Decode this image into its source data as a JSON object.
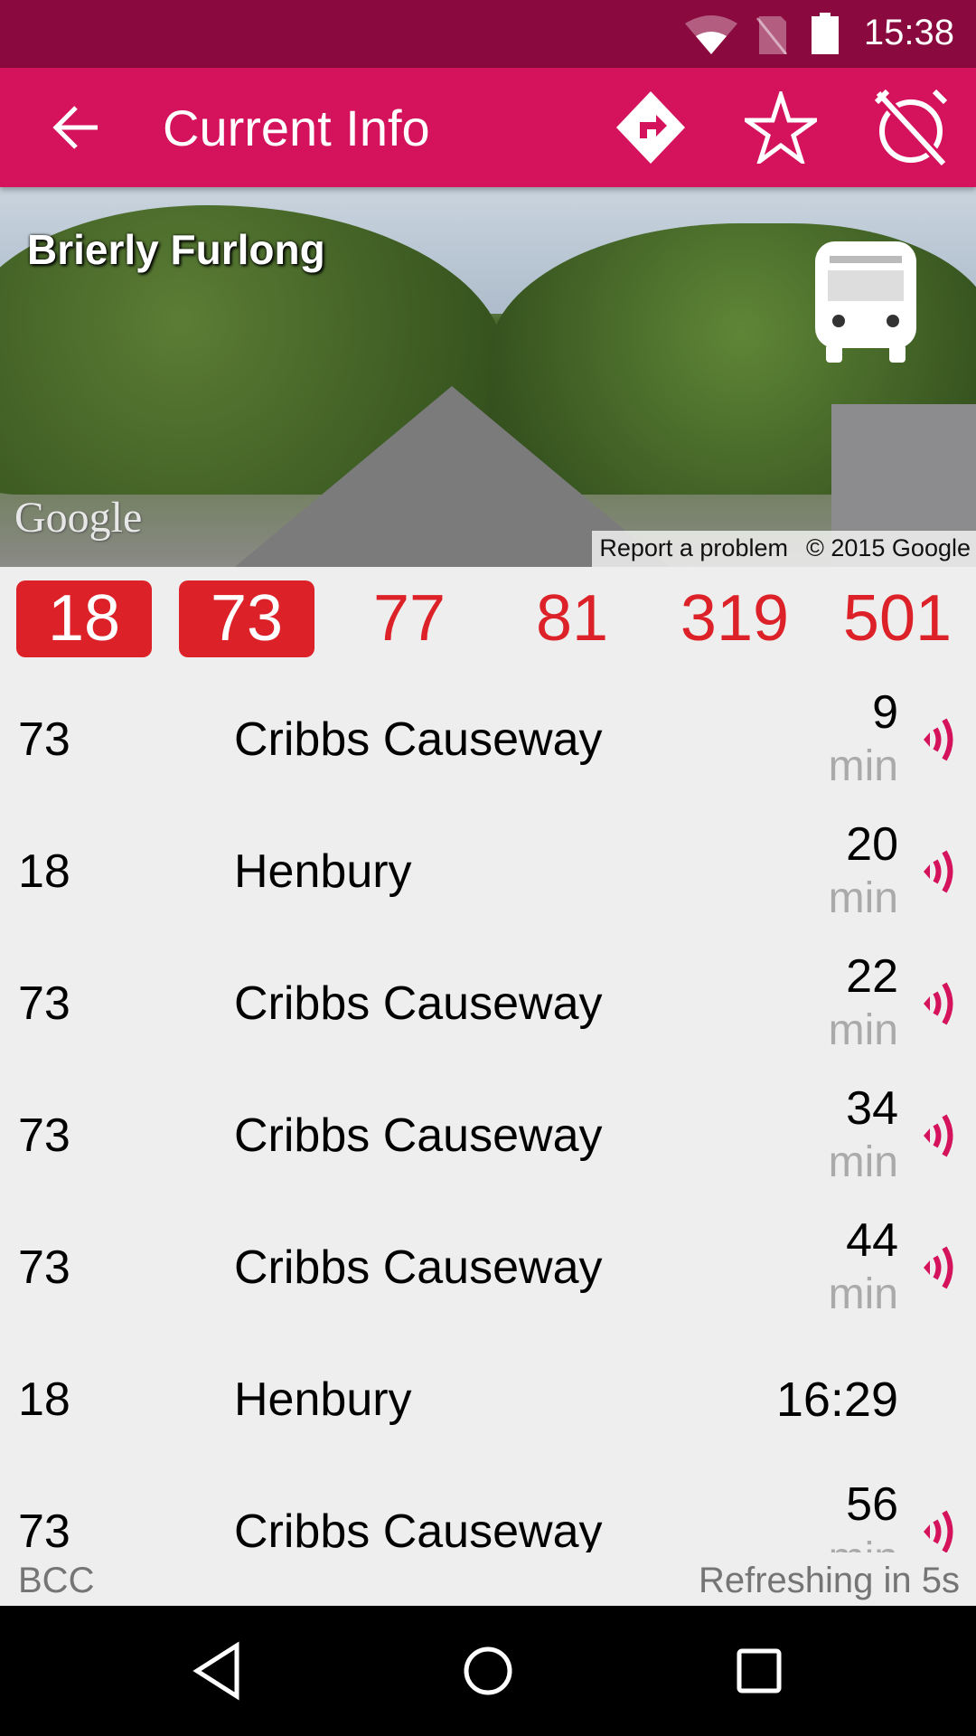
{
  "status_bar": {
    "time": "15:38",
    "icons": [
      "wifi-icon",
      "no-sim-icon",
      "battery-icon"
    ]
  },
  "app_bar": {
    "title": "Current Info",
    "actions": [
      "directions-icon",
      "star-icon",
      "alarm-off-icon"
    ]
  },
  "street_view": {
    "stop_name": "Brierly Furlong",
    "google_logo": "Google",
    "report": "Report a problem",
    "copyright": "© 2015 Google"
  },
  "routes": [
    {
      "label": "18",
      "selected": true
    },
    {
      "label": "73",
      "selected": true
    },
    {
      "label": "77",
      "selected": false
    },
    {
      "label": "81",
      "selected": false
    },
    {
      "label": "319",
      "selected": false
    },
    {
      "label": "501",
      "selected": false
    }
  ],
  "departures": [
    {
      "route": "73",
      "destination": "Cribbs Causeway",
      "value": "9",
      "unit": "min",
      "realtime": true
    },
    {
      "route": "18",
      "destination": "Henbury",
      "value": "20",
      "unit": "min",
      "realtime": true
    },
    {
      "route": "73",
      "destination": "Cribbs Causeway",
      "value": "22",
      "unit": "min",
      "realtime": true
    },
    {
      "route": "73",
      "destination": "Cribbs Causeway",
      "value": "34",
      "unit": "min",
      "realtime": true
    },
    {
      "route": "73",
      "destination": "Cribbs Causeway",
      "value": "44",
      "unit": "min",
      "realtime": true
    },
    {
      "route": "18",
      "destination": "Henbury",
      "value": "16:29",
      "unit": "",
      "realtime": false
    },
    {
      "route": "73",
      "destination": "Cribbs Causeway",
      "value": "56",
      "unit": "min",
      "realtime": true
    }
  ],
  "footer": {
    "source": "BCC",
    "refresh": "Refreshing in 5s"
  },
  "colors": {
    "status_bar": "#8a093e",
    "app_bar": "#d4135c",
    "route_red": "#dc2228",
    "realtime": "#d4135c"
  }
}
